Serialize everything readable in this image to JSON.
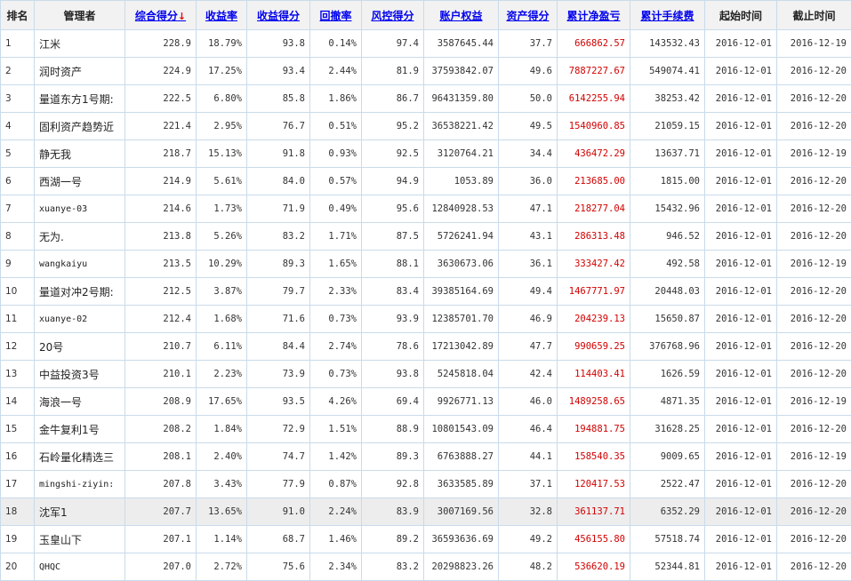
{
  "headers": {
    "rank": "排名",
    "manager": "管理者",
    "composite": "综合得分",
    "composite_sort": "↓",
    "return_rate": "收益率",
    "return_score": "收益得分",
    "drawdown": "回撤率",
    "risk_score": "风控得分",
    "equity": "账户权益",
    "asset_score": "资产得分",
    "cum_pnl": "累计净盈亏",
    "cum_fee": "累计手续费",
    "start": "起始时间",
    "end": "截止时间"
  },
  "colors": {
    "accent_link": "#0000ee",
    "pnl_red": "#d20000",
    "sort_arrow": "#e8000b",
    "border": "#c9dbea"
  },
  "rows": [
    {
      "rank": "1",
      "manager": "江米",
      "composite": "228.9",
      "return_rate": "18.79%",
      "return_score": "93.8",
      "drawdown": "0.14%",
      "risk_score": "97.4",
      "equity": "3587645.44",
      "asset_score": "37.7",
      "cum_pnl": "666862.57",
      "cum_fee": "143532.43",
      "start": "2016-12-01",
      "end": "2016-12-19"
    },
    {
      "rank": "2",
      "manager": "润时资产",
      "composite": "224.9",
      "return_rate": "17.25%",
      "return_score": "93.4",
      "drawdown": "2.44%",
      "risk_score": "81.9",
      "equity": "37593842.07",
      "asset_score": "49.6",
      "cum_pnl": "7887227.67",
      "cum_fee": "549074.41",
      "start": "2016-12-01",
      "end": "2016-12-20"
    },
    {
      "rank": "3",
      "manager": "量道东方1号期:",
      "composite": "222.5",
      "return_rate": "6.80%",
      "return_score": "85.8",
      "drawdown": "1.86%",
      "risk_score": "86.7",
      "equity": "96431359.80",
      "asset_score": "50.0",
      "cum_pnl": "6142255.94",
      "cum_fee": "38253.42",
      "start": "2016-12-01",
      "end": "2016-12-20"
    },
    {
      "rank": "4",
      "manager": "固利资产趋势近",
      "composite": "221.4",
      "return_rate": "2.95%",
      "return_score": "76.7",
      "drawdown": "0.51%",
      "risk_score": "95.2",
      "equity": "36538221.42",
      "asset_score": "49.5",
      "cum_pnl": "1540960.85",
      "cum_fee": "21059.15",
      "start": "2016-12-01",
      "end": "2016-12-20"
    },
    {
      "rank": "5",
      "manager": "静无我",
      "composite": "218.7",
      "return_rate": "15.13%",
      "return_score": "91.8",
      "drawdown": "0.93%",
      "risk_score": "92.5",
      "equity": "3120764.21",
      "asset_score": "34.4",
      "cum_pnl": "436472.29",
      "cum_fee": "13637.71",
      "start": "2016-12-01",
      "end": "2016-12-19"
    },
    {
      "rank": "6",
      "manager": "西湖一号",
      "composite": "214.9",
      "return_rate": "5.61%",
      "return_score": "84.0",
      "drawdown": "0.57%",
      "risk_score": "94.9",
      "equity": "1053.89",
      "asset_score": "36.0",
      "cum_pnl": "213685.00",
      "cum_fee": "1815.00",
      "start": "2016-12-01",
      "end": "2016-12-20"
    },
    {
      "rank": "7",
      "manager": "xuanye-03",
      "composite": "214.6",
      "return_rate": "1.73%",
      "return_score": "71.9",
      "drawdown": "0.49%",
      "risk_score": "95.6",
      "equity": "12840928.53",
      "asset_score": "47.1",
      "cum_pnl": "218277.04",
      "cum_fee": "15432.96",
      "start": "2016-12-01",
      "end": "2016-12-20"
    },
    {
      "rank": "8",
      "manager": "无为.",
      "composite": "213.8",
      "return_rate": "5.26%",
      "return_score": "83.2",
      "drawdown": "1.71%",
      "risk_score": "87.5",
      "equity": "5726241.94",
      "asset_score": "43.1",
      "cum_pnl": "286313.48",
      "cum_fee": "946.52",
      "start": "2016-12-01",
      "end": "2016-12-20"
    },
    {
      "rank": "9",
      "manager": "wangkaiyu",
      "composite": "213.5",
      "return_rate": "10.29%",
      "return_score": "89.3",
      "drawdown": "1.65%",
      "risk_score": "88.1",
      "equity": "3630673.06",
      "asset_score": "36.1",
      "cum_pnl": "333427.42",
      "cum_fee": "492.58",
      "start": "2016-12-01",
      "end": "2016-12-19"
    },
    {
      "rank": "10",
      "manager": "量道对冲2号期:",
      "composite": "212.5",
      "return_rate": "3.87%",
      "return_score": "79.7",
      "drawdown": "2.33%",
      "risk_score": "83.4",
      "equity": "39385164.69",
      "asset_score": "49.4",
      "cum_pnl": "1467771.97",
      "cum_fee": "20448.03",
      "start": "2016-12-01",
      "end": "2016-12-20"
    },
    {
      "rank": "11",
      "manager": "xuanye-02",
      "composite": "212.4",
      "return_rate": "1.68%",
      "return_score": "71.6",
      "drawdown": "0.73%",
      "risk_score": "93.9",
      "equity": "12385701.70",
      "asset_score": "46.9",
      "cum_pnl": "204239.13",
      "cum_fee": "15650.87",
      "start": "2016-12-01",
      "end": "2016-12-20"
    },
    {
      "rank": "12",
      "manager": "20号",
      "composite": "210.7",
      "return_rate": "6.11%",
      "return_score": "84.4",
      "drawdown": "2.74%",
      "risk_score": "78.6",
      "equity": "17213042.89",
      "asset_score": "47.7",
      "cum_pnl": "990659.25",
      "cum_fee": "376768.96",
      "start": "2016-12-01",
      "end": "2016-12-20"
    },
    {
      "rank": "13",
      "manager": "中益投资3号",
      "composite": "210.1",
      "return_rate": "2.23%",
      "return_score": "73.9",
      "drawdown": "0.73%",
      "risk_score": "93.8",
      "equity": "5245818.04",
      "asset_score": "42.4",
      "cum_pnl": "114403.41",
      "cum_fee": "1626.59",
      "start": "2016-12-01",
      "end": "2016-12-20"
    },
    {
      "rank": "14",
      "manager": "海浪一号",
      "composite": "208.9",
      "return_rate": "17.65%",
      "return_score": "93.5",
      "drawdown": "4.26%",
      "risk_score": "69.4",
      "equity": "9926771.13",
      "asset_score": "46.0",
      "cum_pnl": "1489258.65",
      "cum_fee": "4871.35",
      "start": "2016-12-01",
      "end": "2016-12-19"
    },
    {
      "rank": "15",
      "manager": "金牛复利1号",
      "composite": "208.2",
      "return_rate": "1.84%",
      "return_score": "72.9",
      "drawdown": "1.51%",
      "risk_score": "88.9",
      "equity": "10801543.09",
      "asset_score": "46.4",
      "cum_pnl": "194881.75",
      "cum_fee": "31628.25",
      "start": "2016-12-01",
      "end": "2016-12-20"
    },
    {
      "rank": "16",
      "manager": "石岭量化精选三",
      "composite": "208.1",
      "return_rate": "2.40%",
      "return_score": "74.7",
      "drawdown": "1.42%",
      "risk_score": "89.3",
      "equity": "6763888.27",
      "asset_score": "44.1",
      "cum_pnl": "158540.35",
      "cum_fee": "9009.65",
      "start": "2016-12-01",
      "end": "2016-12-19"
    },
    {
      "rank": "17",
      "manager": "mingshi-ziyin:",
      "composite": "207.8",
      "return_rate": "3.43%",
      "return_score": "77.9",
      "drawdown": "0.87%",
      "risk_score": "92.8",
      "equity": "3633585.89",
      "asset_score": "37.1",
      "cum_pnl": "120417.53",
      "cum_fee": "2522.47",
      "start": "2016-12-01",
      "end": "2016-12-20"
    },
    {
      "rank": "18",
      "manager": "沈军1",
      "composite": "207.7",
      "return_rate": "13.65%",
      "return_score": "91.0",
      "drawdown": "2.24%",
      "risk_score": "83.9",
      "equity": "3007169.56",
      "asset_score": "32.8",
      "cum_pnl": "361137.71",
      "cum_fee": "6352.29",
      "start": "2016-12-01",
      "end": "2016-12-20"
    },
    {
      "rank": "19",
      "manager": "玉皇山下",
      "composite": "207.1",
      "return_rate": "1.14%",
      "return_score": "68.7",
      "drawdown": "1.46%",
      "risk_score": "89.2",
      "equity": "36593636.69",
      "asset_score": "49.2",
      "cum_pnl": "456155.80",
      "cum_fee": "57518.74",
      "start": "2016-12-01",
      "end": "2016-12-20"
    },
    {
      "rank": "20",
      "manager": "QHQC",
      "composite": "207.0",
      "return_rate": "2.72%",
      "return_score": "75.6",
      "drawdown": "2.34%",
      "risk_score": "83.2",
      "equity": "20298823.26",
      "asset_score": "48.2",
      "cum_pnl": "536620.19",
      "cum_fee": "52344.81",
      "start": "2016-12-01",
      "end": "2016-12-20"
    }
  ]
}
